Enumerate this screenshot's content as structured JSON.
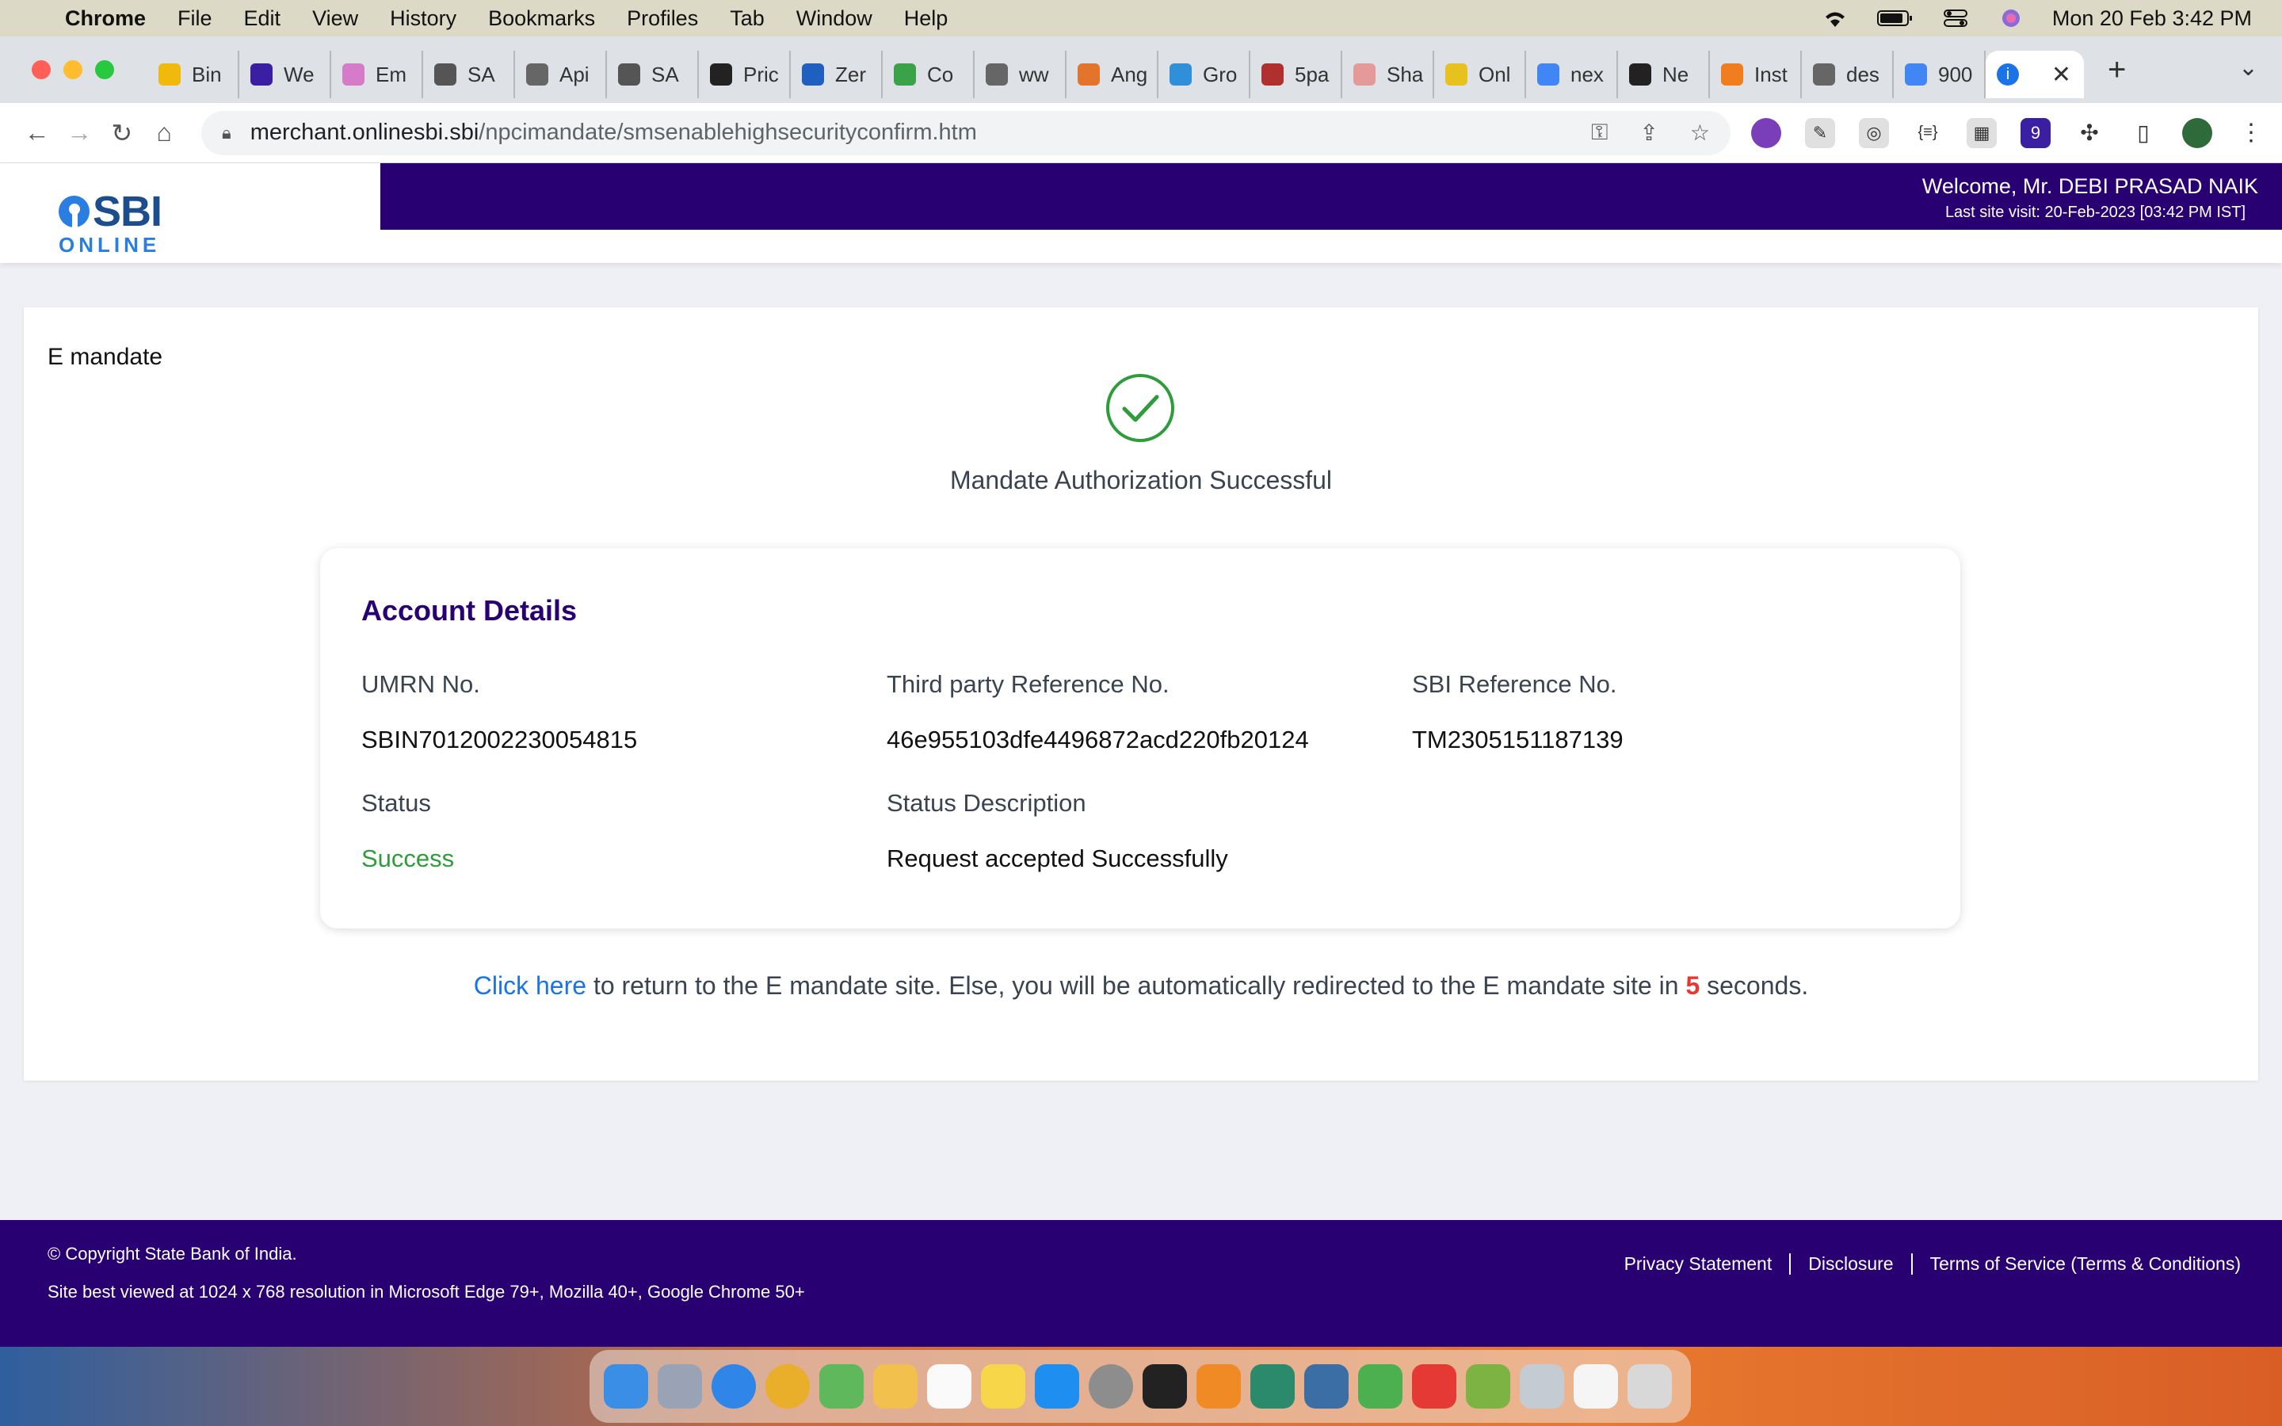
{
  "menubar": {
    "app": "Chrome",
    "items": [
      "File",
      "Edit",
      "View",
      "History",
      "Bookmarks",
      "Profiles",
      "Tab",
      "Window",
      "Help"
    ],
    "clock": "Mon 20 Feb  3:42 PM"
  },
  "tabs": [
    {
      "label": "Bin",
      "color": "#f0b90b"
    },
    {
      "label": "We",
      "color": "#3b1fa3"
    },
    {
      "label": "Em",
      "color": "#d67bc8"
    },
    {
      "label": "SA",
      "color": "#555555"
    },
    {
      "label": "Api",
      "color": "#666666"
    },
    {
      "label": "SA",
      "color": "#555555"
    },
    {
      "label": "Pric",
      "color": "#222222"
    },
    {
      "label": "Zer",
      "color": "#1f5fbf"
    },
    {
      "label": "Co",
      "color": "#3aa34a"
    },
    {
      "label": "ww",
      "color": "#666666"
    },
    {
      "label": "Ang",
      "color": "#e3742b"
    },
    {
      "label": "Gro",
      "color": "#2f8fd9"
    },
    {
      "label": "5pa",
      "color": "#b03030"
    },
    {
      "label": "Sha",
      "color": "#e59a9a"
    },
    {
      "label": "Onl",
      "color": "#e7c21f"
    },
    {
      "label": "nex",
      "color": "#4285f4"
    },
    {
      "label": "Ne",
      "color": "#222222"
    },
    {
      "label": "Inst",
      "color": "#f07d1e"
    },
    {
      "label": "des",
      "color": "#666666"
    },
    {
      "label": "900",
      "color": "#4285f4"
    }
  ],
  "url": {
    "host": "merchant.onlinesbi.sbi",
    "path": "/npcimandate/smsenablehighsecurityconfirm.htm"
  },
  "header": {
    "logo_top": "SBI",
    "logo_bottom": "ONLINE",
    "welcome": "Welcome, Mr. DEBI PRASAD NAIK",
    "last_visit": "Last site visit: 20-Feb-2023 [03:42 PM IST]"
  },
  "main": {
    "title": "E mandate",
    "success_message": "Mandate Authorization Successful",
    "details_heading": "Account Details",
    "fields": {
      "umrn_label": "UMRN No.",
      "umrn_value": "SBIN7012002230054815",
      "third_party_label": "Third party Reference No.",
      "third_party_value": "46e955103dfe4496872acd220fb20124",
      "sbi_ref_label": "SBI Reference No.",
      "sbi_ref_value": "TM2305151187139",
      "status_label": "Status",
      "status_value": "Success",
      "status_desc_label": "Status Description",
      "status_desc_value": "Request accepted Successfully"
    },
    "redirect": {
      "link": "Click here",
      "text_before": " to return to the E mandate site. Else, you will be automatically redirected to the E mandate site in ",
      "seconds": "5",
      "text_after": " seconds."
    }
  },
  "footer": {
    "copyright": "© Copyright State Bank of India.",
    "best_viewed": "Site best viewed at 1024 x 768 resolution in Microsoft Edge 79+, Mozilla 40+, Google Chrome 50+",
    "links": [
      "Privacy Statement",
      "Disclosure",
      "Terms of Service (Terms & Conditions)"
    ]
  },
  "colors": {
    "brand_purple": "#280071",
    "success_green": "#2e9c3b",
    "link_blue": "#1a73e8",
    "countdown_red": "#e53935"
  }
}
